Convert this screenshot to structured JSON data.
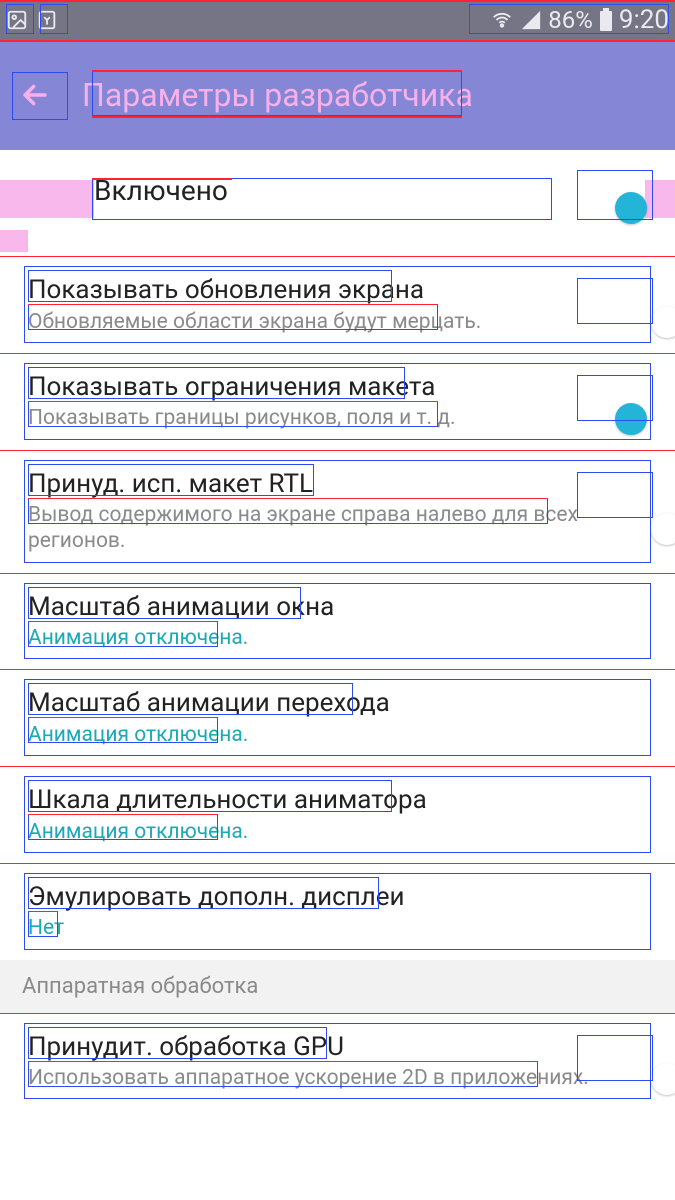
{
  "statusbar": {
    "battery_pct": "86%",
    "clock": "9:20"
  },
  "actionbar": {
    "title": "Параметры разработчика"
  },
  "master": {
    "label": "Включено",
    "on": true
  },
  "settings": [
    {
      "title": "Показывать обновления экрана",
      "sub": "Обновляемые области экрана будут мерцать.",
      "toggle": true,
      "on": false
    },
    {
      "title": "Показывать ограничения макета",
      "sub": "Показывать границы рисунков, поля и т. д.",
      "toggle": true,
      "on": true
    },
    {
      "title": "Принуд. исп. макет RTL",
      "sub": "Вывод содержимого на экране справа налево для всех регионов.",
      "toggle": true,
      "on": false
    },
    {
      "title": "Масштаб анимации окна",
      "sub": "Анимация отключена.",
      "sub_link": true
    },
    {
      "title": "Масштаб анимации перехода",
      "sub": "Анимация отключена.",
      "sub_link": true
    },
    {
      "title": "Шкала длительности аниматора",
      "sub": "Анимация отключена.",
      "sub_link": true
    },
    {
      "title": "Эмулировать дополн. дисплеи",
      "sub": "Нет",
      "sub_link": true
    }
  ],
  "section_header": "Аппаратная обработка",
  "settings2": [
    {
      "title": "Принудит. обработка GPU",
      "sub": "Использовать аппаратное ускорение 2D в приложениях.",
      "toggle": true,
      "on": false
    }
  ],
  "icons": {
    "image": "image-icon",
    "recycle": "recycle-icon",
    "wifi": "wifi-icon",
    "signal": "signal-icon",
    "battery": "battery-icon",
    "back": "back-arrow-icon"
  }
}
